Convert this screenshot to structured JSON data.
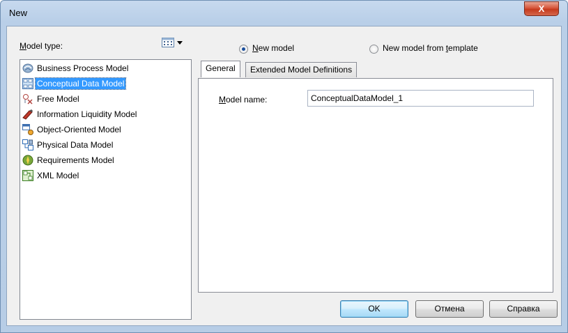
{
  "window": {
    "title": "New",
    "close_glyph": "X"
  },
  "model_type": {
    "label": "Model type:",
    "label_underline": "M",
    "label_rest": "odel type:",
    "view_icon": "list-view-icon",
    "items": [
      {
        "label": "Business Process Model",
        "icon": "business-process-icon",
        "selected": false
      },
      {
        "label": "Conceptual Data Model",
        "icon": "conceptual-data-icon",
        "selected": true
      },
      {
        "label": "Free Model",
        "icon": "free-model-icon",
        "selected": false
      },
      {
        "label": "Information Liquidity Model",
        "icon": "information-liquidity-icon",
        "selected": false
      },
      {
        "label": "Object-Oriented Model",
        "icon": "object-oriented-icon",
        "selected": false
      },
      {
        "label": "Physical Data Model",
        "icon": "physical-data-icon",
        "selected": false
      },
      {
        "label": "Requirements Model",
        "icon": "requirements-icon",
        "selected": false
      },
      {
        "label": "XML Model",
        "icon": "xml-model-icon",
        "selected": false
      }
    ]
  },
  "mode": {
    "new_model": {
      "label": "New model",
      "u": "N",
      "rest": "ew model",
      "checked": true
    },
    "from_template": {
      "label": "New model from template",
      "pre": "New model from ",
      "u": "t",
      "rest": "emplate",
      "checked": false
    }
  },
  "tabs": [
    {
      "label": "General",
      "active": true
    },
    {
      "label": "Extended Model Definitions",
      "active": false
    }
  ],
  "general": {
    "model_name_label": "Model name:",
    "model_name_u": "M",
    "model_name_rest": "odel name:",
    "model_name_value": "ConceptualDataModel_1"
  },
  "buttons": {
    "ok": "OK",
    "cancel": "Отмена",
    "help": "Справка"
  },
  "colors": {
    "selection": "#3399ff",
    "title_bar": "#b9cfe8",
    "close": "#c53a1d"
  }
}
